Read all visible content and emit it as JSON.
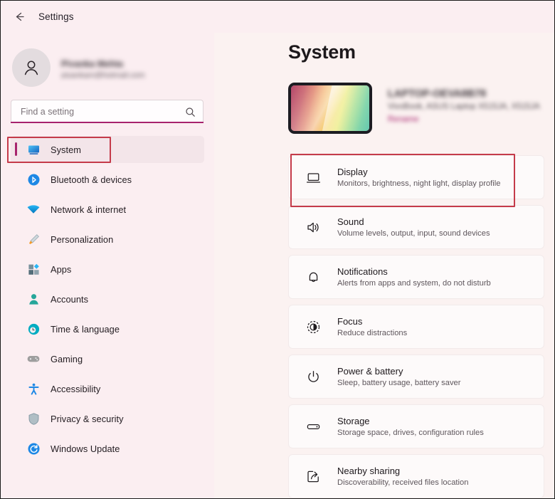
{
  "window": {
    "title": "Settings",
    "back_icon": "back-arrow-icon"
  },
  "account": {
    "name": "Piyanka Mehta",
    "email": "piyankam@hotmail.com",
    "avatar_icon": "person-avatar-icon",
    "redacted": true
  },
  "search": {
    "placeholder": "Find a setting",
    "value": "",
    "icon": "search-icon",
    "focus_accent": "#a7236d"
  },
  "sidebar": {
    "items": [
      {
        "label": "System",
        "icon": "monitor-icon",
        "selected": true
      },
      {
        "label": "Bluetooth & devices",
        "icon": "bluetooth-icon",
        "selected": false
      },
      {
        "label": "Network & internet",
        "icon": "wifi-icon",
        "selected": false
      },
      {
        "label": "Personalization",
        "icon": "paintbrush-icon",
        "selected": false
      },
      {
        "label": "Apps",
        "icon": "apps-grid-icon",
        "selected": false
      },
      {
        "label": "Accounts",
        "icon": "person-icon",
        "selected": false
      },
      {
        "label": "Time & language",
        "icon": "clock-globe-icon",
        "selected": false
      },
      {
        "label": "Gaming",
        "icon": "gamepad-icon",
        "selected": false
      },
      {
        "label": "Accessibility",
        "icon": "accessibility-icon",
        "selected": false
      },
      {
        "label": "Privacy & security",
        "icon": "shield-icon",
        "selected": false
      },
      {
        "label": "Windows Update",
        "icon": "update-sync-icon",
        "selected": false
      }
    ]
  },
  "main": {
    "title": "System",
    "device": {
      "name": "LAPTOP-OEVA8B78",
      "specs": "VivoBook, ASUS Laptop X515JA, X515JA",
      "rename_label": "Rename",
      "thumbnail_icon": "laptop-thumbnail-image",
      "redacted": true
    },
    "cards": [
      {
        "title": "Display",
        "subtitle": "Monitors, brightness, night light, display profile",
        "icon": "display-monitor-icon",
        "highlighted": true
      },
      {
        "title": "Sound",
        "subtitle": "Volume levels, output, input, sound devices",
        "icon": "speaker-sound-icon",
        "highlighted": false
      },
      {
        "title": "Notifications",
        "subtitle": "Alerts from apps and system, do not disturb",
        "icon": "bell-icon",
        "highlighted": false
      },
      {
        "title": "Focus",
        "subtitle": "Reduce distractions",
        "icon": "focus-circle-icon",
        "highlighted": false
      },
      {
        "title": "Power & battery",
        "subtitle": "Sleep, battery usage, battery saver",
        "icon": "power-icon",
        "highlighted": false
      },
      {
        "title": "Storage",
        "subtitle": "Storage space, drives, configuration rules",
        "icon": "storage-drive-icon",
        "highlighted": false
      },
      {
        "title": "Nearby sharing",
        "subtitle": "Discoverability, received files location",
        "icon": "share-box-icon",
        "highlighted": false
      }
    ]
  },
  "annotations": {
    "color": "#c53b4a",
    "boxes": [
      {
        "target": "sidebar-item-system"
      },
      {
        "target": "settings-card-display"
      }
    ]
  }
}
